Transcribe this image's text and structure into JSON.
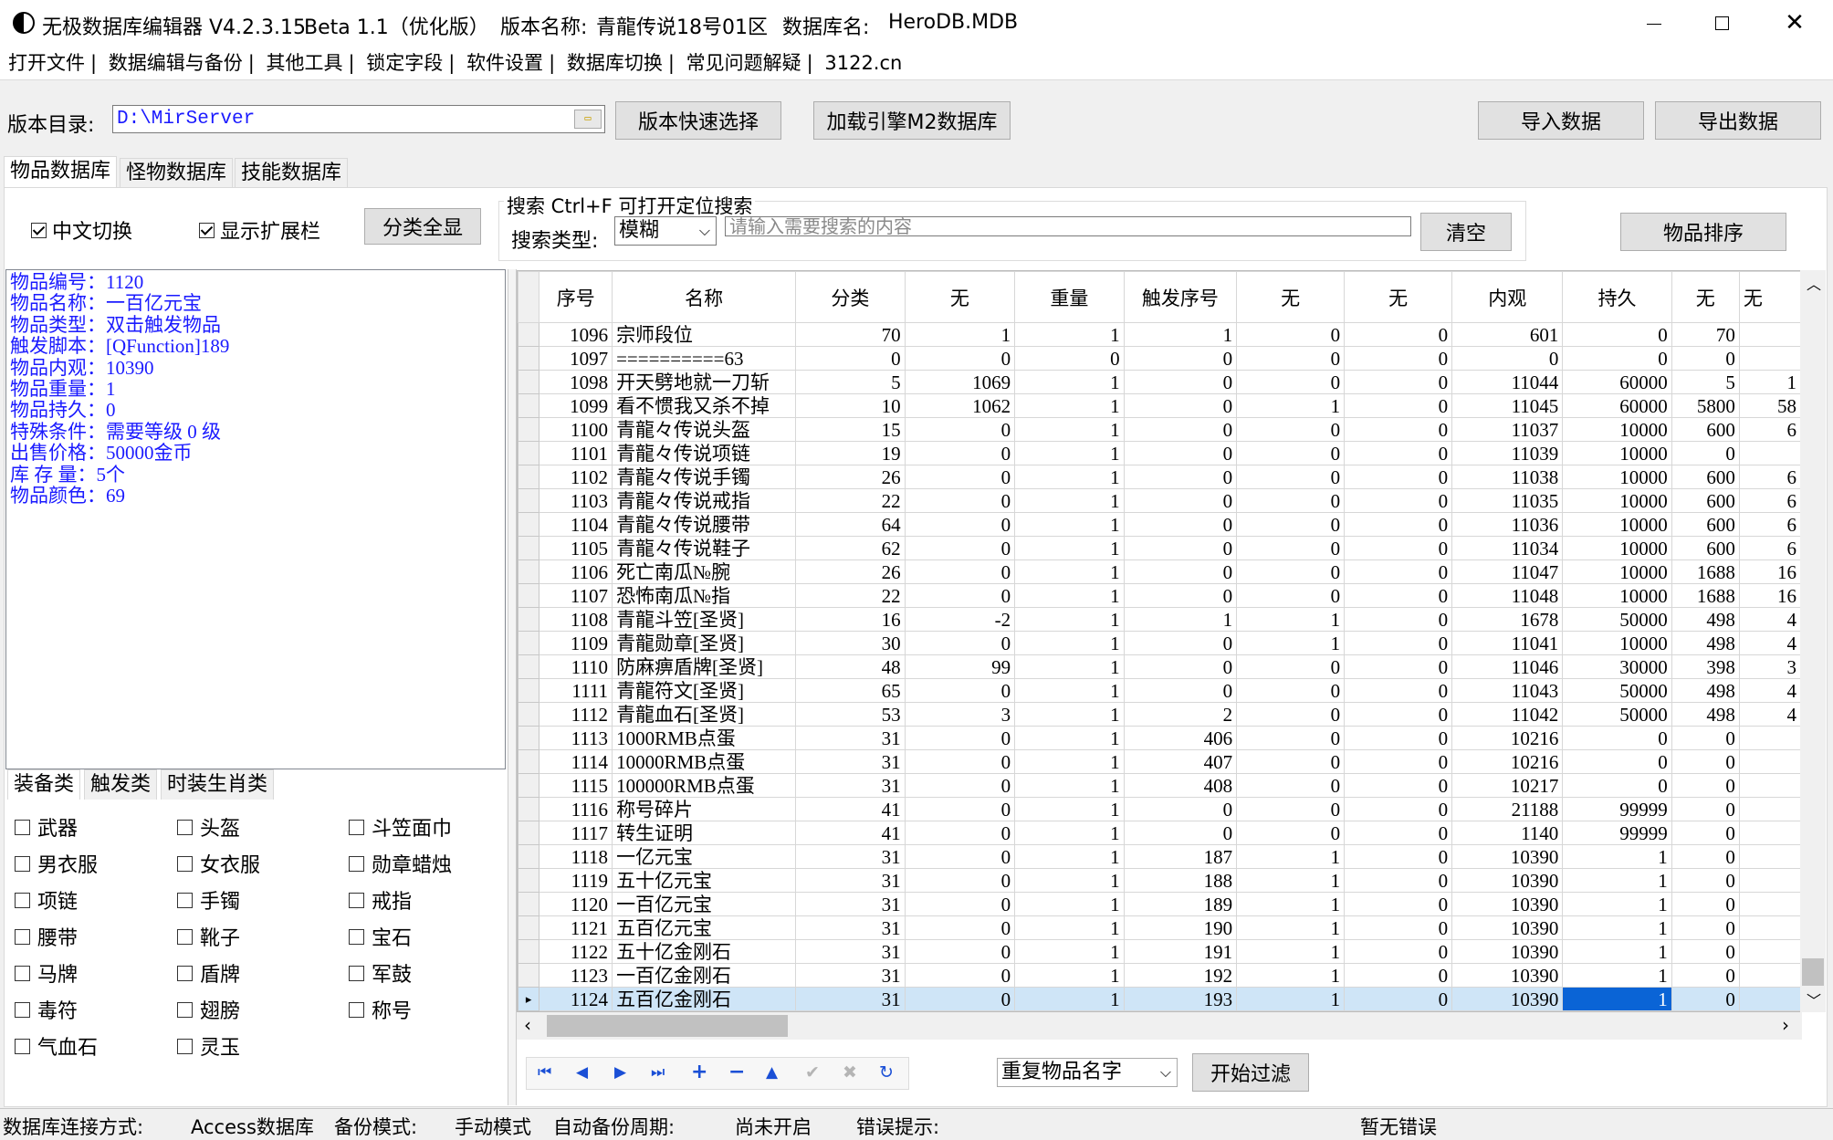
{
  "window": {
    "title": "无极数据库编辑器 V4.2.3.15",
    "beta": "Beta 1.1（优化版）",
    "version_label": "版本名称:",
    "version_name": "青龍传说18号01区",
    "db_label": "数据库名:",
    "db_name": "HeroDB.MDB"
  },
  "menu": [
    "打开文件",
    "数据编辑与备份",
    "其他工具",
    "锁定字段",
    "软件设置",
    "数据库切换",
    "常见问题解疑",
    "3122.cn"
  ],
  "toolbar": {
    "dir_label": "版本目录:",
    "dir_value": "D:\\MirServer",
    "quick_select": "版本快速选择",
    "load_m2": "加载引擎M2数据库",
    "import": "导入数据",
    "export": "导出数据"
  },
  "db_tabs": [
    "物品数据库",
    "怪物数据库",
    "技能数据库"
  ],
  "options": {
    "chinese_toggle": "中文切换",
    "show_ext": "显示扩展栏",
    "show_all": "分类全显"
  },
  "search": {
    "title": "搜索 Ctrl+F 可打开定位搜索",
    "type_label": "搜索类型:",
    "type_value": "模糊",
    "placeholder": "请输入需要搜索的内容",
    "clear": "清空",
    "sort": "物品排序"
  },
  "info_lines": [
    "物品编号：1120",
    "物品名称：一百亿元宝",
    "物品类型：双击触发物品",
    "触发脚本：[QFunction]189",
    "物品内观：10390",
    "物品重量：1",
    "物品持久：0",
    "特殊条件：需要等级 0 级",
    "出售价格：50000金币",
    "库 存 量：5个",
    "物品颜色：69"
  ],
  "category_tabs": [
    "装备类",
    "触发类",
    "时装生肖类"
  ],
  "equip_items": [
    [
      "武器",
      "头盔",
      "斗笠面巾"
    ],
    [
      "男衣服",
      "女衣服",
      "勋章蜡烛"
    ],
    [
      "项链",
      "手镯",
      "戒指"
    ],
    [
      "腰带",
      "靴子",
      "宝石"
    ],
    [
      "马牌",
      "盾牌",
      "军鼓"
    ],
    [
      "毒符",
      "翅膀",
      "称号"
    ],
    [
      "气血石",
      "灵玉",
      ""
    ]
  ],
  "grid": {
    "headers": [
      "序号",
      "名称",
      "分类",
      "无",
      "重量",
      "触发序号",
      "无",
      "无",
      "内观",
      "持久",
      "无",
      "无"
    ],
    "rows": [
      [
        "1096",
        "宗师段位",
        "70",
        "1",
        "1",
        "1",
        "0",
        "0",
        "601",
        "0",
        "70",
        ""
      ],
      [
        "1097",
        "==========63",
        "0",
        "0",
        "0",
        "0",
        "0",
        "0",
        "0",
        "0",
        "0",
        ""
      ],
      [
        "1098",
        "开天劈地就一刀斩",
        "5",
        "1069",
        "1",
        "0",
        "0",
        "0",
        "11044",
        "60000",
        "5",
        "1"
      ],
      [
        "1099",
        "看不惯我又杀不掉",
        "10",
        "1062",
        "1",
        "0",
        "1",
        "0",
        "11045",
        "60000",
        "5800",
        "58"
      ],
      [
        "1100",
        "青龍々传说头盔",
        "15",
        "0",
        "1",
        "0",
        "0",
        "0",
        "11037",
        "10000",
        "600",
        "6"
      ],
      [
        "1101",
        "青龍々传说项链",
        "19",
        "0",
        "1",
        "0",
        "0",
        "0",
        "11039",
        "10000",
        "0",
        ""
      ],
      [
        "1102",
        "青龍々传说手镯",
        "26",
        "0",
        "1",
        "0",
        "0",
        "0",
        "11038",
        "10000",
        "600",
        "6"
      ],
      [
        "1103",
        "青龍々传说戒指",
        "22",
        "0",
        "1",
        "0",
        "0",
        "0",
        "11035",
        "10000",
        "600",
        "6"
      ],
      [
        "1104",
        "青龍々传说腰带",
        "64",
        "0",
        "1",
        "0",
        "0",
        "0",
        "11036",
        "10000",
        "600",
        "6"
      ],
      [
        "1105",
        "青龍々传说鞋子",
        "62",
        "0",
        "1",
        "0",
        "0",
        "0",
        "11034",
        "10000",
        "600",
        "6"
      ],
      [
        "1106",
        "死亡南瓜№腕",
        "26",
        "0",
        "1",
        "0",
        "0",
        "0",
        "11047",
        "10000",
        "1688",
        "16"
      ],
      [
        "1107",
        "恐怖南瓜№指",
        "22",
        "0",
        "1",
        "0",
        "0",
        "0",
        "11048",
        "10000",
        "1688",
        "16"
      ],
      [
        "1108",
        "青龍斗笠[圣贤]",
        "16",
        "-2",
        "1",
        "1",
        "1",
        "0",
        "1678",
        "50000",
        "498",
        "4"
      ],
      [
        "1109",
        "青龍勋章[圣贤]",
        "30",
        "0",
        "1",
        "0",
        "1",
        "0",
        "11041",
        "10000",
        "498",
        "4"
      ],
      [
        "1110",
        "防麻痹盾牌[圣贤]",
        "48",
        "99",
        "1",
        "0",
        "0",
        "0",
        "11046",
        "30000",
        "398",
        "3"
      ],
      [
        "1111",
        "青龍符文[圣贤]",
        "65",
        "0",
        "1",
        "0",
        "0",
        "0",
        "11043",
        "50000",
        "498",
        "4"
      ],
      [
        "1112",
        "青龍血石[圣贤]",
        "53",
        "3",
        "1",
        "2",
        "0",
        "0",
        "11042",
        "50000",
        "498",
        "4"
      ],
      [
        "1113",
        "1000RMB点蛋",
        "31",
        "0",
        "1",
        "406",
        "0",
        "0",
        "10216",
        "0",
        "0",
        ""
      ],
      [
        "1114",
        "10000RMB点蛋",
        "31",
        "0",
        "1",
        "407",
        "0",
        "0",
        "10216",
        "0",
        "0",
        ""
      ],
      [
        "1115",
        "100000RMB点蛋",
        "31",
        "0",
        "1",
        "408",
        "0",
        "0",
        "10217",
        "0",
        "0",
        ""
      ],
      [
        "1116",
        "称号碎片",
        "41",
        "0",
        "1",
        "0",
        "0",
        "0",
        "21188",
        "99999",
        "0",
        ""
      ],
      [
        "1117",
        "转生证明",
        "41",
        "0",
        "1",
        "0",
        "0",
        "0",
        "1140",
        "99999",
        "0",
        ""
      ],
      [
        "1118",
        "一亿元宝",
        "31",
        "0",
        "1",
        "187",
        "1",
        "0",
        "10390",
        "1",
        "0",
        ""
      ],
      [
        "1119",
        "五十亿元宝",
        "31",
        "0",
        "1",
        "188",
        "1",
        "0",
        "10390",
        "1",
        "0",
        ""
      ],
      [
        "1120",
        "一百亿元宝",
        "31",
        "0",
        "1",
        "189",
        "1",
        "0",
        "10390",
        "1",
        "0",
        ""
      ],
      [
        "1121",
        "五百亿元宝",
        "31",
        "0",
        "1",
        "190",
        "1",
        "0",
        "10390",
        "1",
        "0",
        ""
      ],
      [
        "1122",
        "五十亿金刚石",
        "31",
        "0",
        "1",
        "191",
        "1",
        "0",
        "10390",
        "1",
        "0",
        ""
      ],
      [
        "1123",
        "一百亿金刚石",
        "31",
        "0",
        "1",
        "192",
        "1",
        "0",
        "10390",
        "1",
        "0",
        ""
      ],
      [
        "1124",
        "五百亿金刚石",
        "31",
        "0",
        "1",
        "193",
        "1",
        "0",
        "10390",
        "1",
        "0",
        ""
      ]
    ]
  },
  "filter": {
    "select_value": "重复物品名字",
    "start": "开始过滤"
  },
  "status": {
    "conn_label": "数据库连接方式:",
    "conn_value": "Access数据库",
    "backup_label": "备份模式:",
    "backup_value": "手动模式",
    "auto_label": "自动备份周期:",
    "auto_value": "尚未开启",
    "err_label": "错误提示:",
    "err_value": "暂无错误"
  }
}
